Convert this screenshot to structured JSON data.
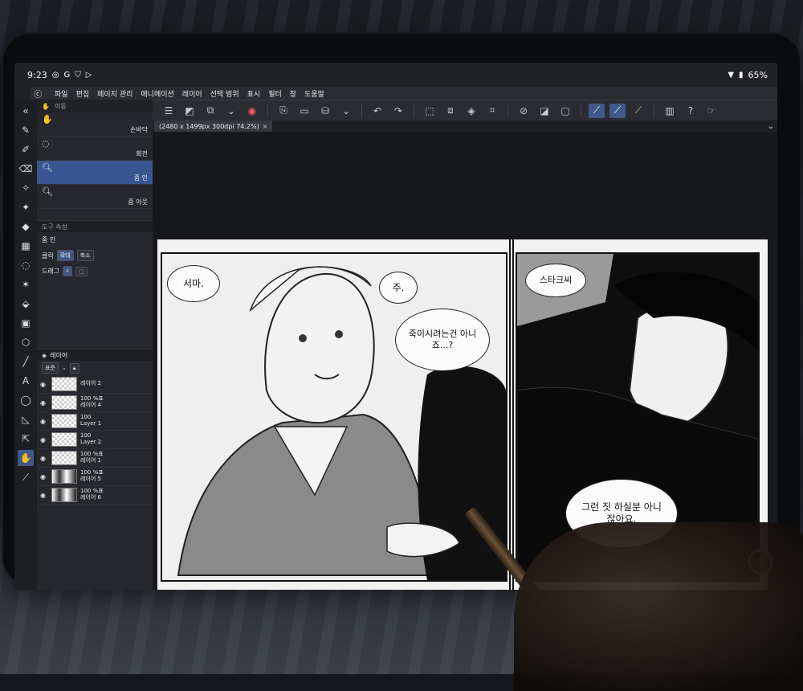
{
  "status_bar": {
    "time": "9:23",
    "battery": "65%",
    "icons": [
      "gmail-icon",
      "google-icon",
      "shield-icon",
      "play-icon",
      "wifi-icon",
      "battery-icon"
    ]
  },
  "menu": {
    "items": [
      "파일",
      "편집",
      "페이지 관리",
      "애니메이션",
      "레이어",
      "선택 범위",
      "표시",
      "필터",
      "창",
      "도움말"
    ]
  },
  "document_tab": {
    "title": "(2480 x 1499px 300dpi 74.2%)",
    "close": "×"
  },
  "subtool": {
    "items": [
      {
        "label": "손바닥",
        "icon": "hand-icon"
      },
      {
        "label": "회전",
        "icon": "rotate-icon"
      },
      {
        "label": "줌 인",
        "icon": "zoom-in-icon",
        "selected": true
      },
      {
        "label": "줌 아웃",
        "icon": "zoom-out-icon"
      }
    ],
    "header": "이동"
  },
  "tool_property": {
    "tab_label": "도구 속성",
    "title": "줌 인",
    "click_label": "클릭",
    "click_option_1": "확대",
    "click_option_2": "축소",
    "drag_label": "드래그"
  },
  "layers": {
    "header": "레이어",
    "blend_mode": "표준",
    "rows": [
      {
        "opacity": "",
        "name": "레이어 2"
      },
      {
        "opacity": "100 %표",
        "name": "레이어 4"
      },
      {
        "opacity": "100",
        "name": "Layer 1"
      },
      {
        "opacity": "100",
        "name": "Layer 2"
      },
      {
        "opacity": "100 %표",
        "name": "레이어 1"
      },
      {
        "opacity": "100 %표",
        "name": "레이어 5"
      },
      {
        "opacity": "100 %표",
        "name": "레이어 6"
      }
    ]
  },
  "canvas": {
    "bubbles": {
      "b1": "서마.",
      "b2": "주.",
      "b3": "죽이시려는건 아니죠...?",
      "b4": "스타크씨",
      "b5": "그런 짓 하실분 아니잖아요."
    }
  },
  "colors": {
    "accent": "#3f5a8a",
    "panel_bg": "#26282d",
    "toolbar_bg": "#2a2c31"
  }
}
